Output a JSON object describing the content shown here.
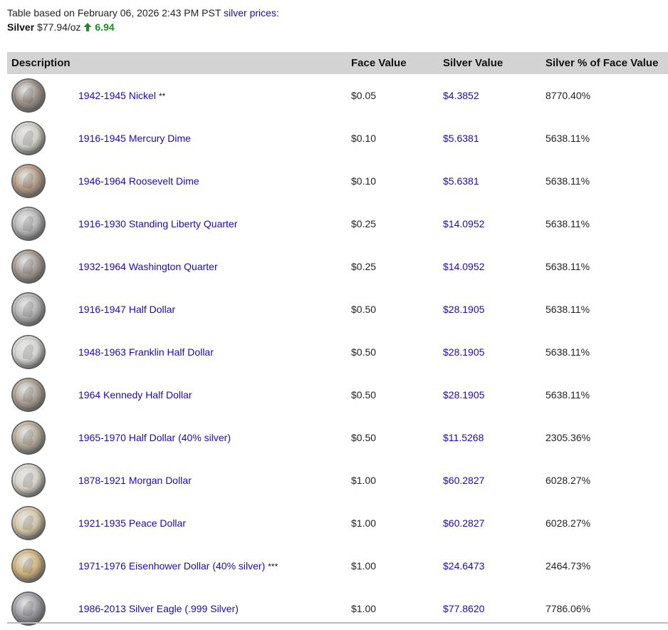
{
  "header": {
    "table_based_text": "Table based on February 06, 2026 2:43 PM PST",
    "silver_prices_link": "silver prices",
    "colon": ":",
    "metal_label": "Silver",
    "price": "$77.94/oz",
    "change": "6.94",
    "change_icon": "up-arrow-icon",
    "change_color": "#1f8a1f"
  },
  "table": {
    "headers": {
      "description": "Description",
      "face_value": "Face Value",
      "silver_value": "Silver Value",
      "silver_pct": "Silver % of Face Value"
    },
    "rows": [
      {
        "coin": "1942-1945 Nickel",
        "suffix": "**",
        "face": "$0.05",
        "silver": "$4.3852",
        "pct": "8770.40%",
        "tone": "#9a8f86"
      },
      {
        "coin": "1916-1945 Mercury Dime",
        "suffix": "",
        "face": "$0.10",
        "silver": "$5.6381",
        "pct": "5638.11%",
        "tone": "#cfcdc6"
      },
      {
        "coin": "1946-1964 Roosevelt Dime",
        "suffix": "",
        "face": "$0.10",
        "silver": "$5.6381",
        "pct": "5638.11%",
        "tone": "#b39a83"
      },
      {
        "coin": "1916-1930 Standing Liberty Quarter",
        "suffix": "",
        "face": "$0.25",
        "silver": "$14.0952",
        "pct": "5638.11%",
        "tone": "#b4b4b4"
      },
      {
        "coin": "1932-1964 Washington Quarter",
        "suffix": "",
        "face": "$0.25",
        "silver": "$14.0952",
        "pct": "5638.11%",
        "tone": "#a39791"
      },
      {
        "coin": "1916-1947 Half Dollar",
        "suffix": "",
        "face": "$0.50",
        "silver": "$28.1905",
        "pct": "5638.11%",
        "tone": "#b0b0b0"
      },
      {
        "coin": "1948-1963 Franklin Half Dollar",
        "suffix": "",
        "face": "$0.50",
        "silver": "$28.1905",
        "pct": "5638.11%",
        "tone": "#d2d2d0"
      },
      {
        "coin": "1964 Kennedy Half Dollar",
        "suffix": "",
        "face": "$0.50",
        "silver": "$28.1905",
        "pct": "5638.11%",
        "tone": "#aa9f92"
      },
      {
        "coin": "1965-1970 Half Dollar (40% silver)",
        "suffix": "",
        "face": "$0.50",
        "silver": "$11.5268",
        "pct": "2305.36%",
        "tone": "#b3a898"
      },
      {
        "coin": "1878-1921 Morgan Dollar",
        "suffix": "",
        "face": "$1.00",
        "silver": "$60.2827",
        "pct": "6028.27%",
        "tone": "#d4d0c6"
      },
      {
        "coin": "1921-1935 Peace Dollar",
        "suffix": "",
        "face": "$1.00",
        "silver": "$60.2827",
        "pct": "6028.27%",
        "tone": "#d1c4a6"
      },
      {
        "coin": "1971-1976 Eisenhower Dollar (40% silver)",
        "suffix": "***",
        "face": "$1.00",
        "silver": "$24.6473",
        "pct": "2464.73%",
        "tone": "#cdb27a"
      },
      {
        "coin": "1986-2013 Silver Eagle (.999 Silver)",
        "suffix": "",
        "face": "$1.00",
        "silver": "$77.8620",
        "pct": "7786.06%",
        "tone": "#9b9ba0"
      }
    ]
  }
}
